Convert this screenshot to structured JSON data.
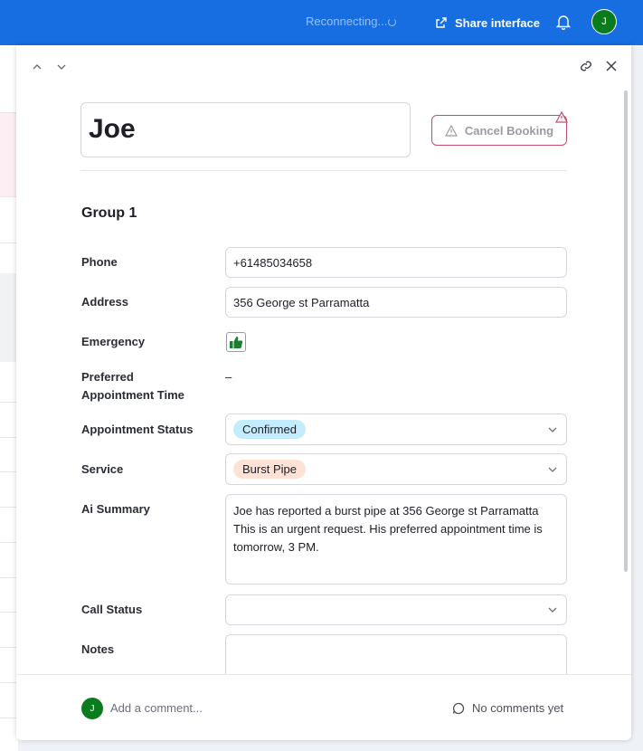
{
  "topbar": {
    "status": "Reconnecting...",
    "share_label": "Share interface",
    "user_initial": "J"
  },
  "record": {
    "title": "Joe",
    "cancel_label": "Cancel Booking",
    "group_title": "Group 1"
  },
  "fields": {
    "phone": {
      "label": "Phone",
      "value": "+61485034658"
    },
    "address": {
      "label": "Address",
      "value": "356 George st Parramatta"
    },
    "emergency": {
      "label": "Emergency",
      "checked": true
    },
    "preferred_time": {
      "label_line1": "Preferred",
      "label_line2": "Appointment Time",
      "value": "–"
    },
    "appointment_status": {
      "label": "Appointment Status",
      "value": "Confirmed",
      "color": "#c4ecff"
    },
    "service": {
      "label": "Service",
      "value": "Burst Pipe",
      "color": "#fee2d5"
    },
    "ai_summary": {
      "label": "Ai Summary",
      "value": "Joe has reported a burst pipe at 356 George st Parramatta This is an urgent request. His preferred appointment time is tomorrow, 3 PM."
    },
    "call_status": {
      "label": "Call Status",
      "value": ""
    },
    "notes": {
      "label": "Notes",
      "value": ""
    }
  },
  "footer": {
    "user_initial": "J",
    "comment_placeholder": "Add a comment...",
    "comments_status": "No comments yet"
  },
  "colors": {
    "accent": "#166ee1",
    "avatar": "#0b7c1d",
    "cancel_border": "#c44d6d"
  }
}
